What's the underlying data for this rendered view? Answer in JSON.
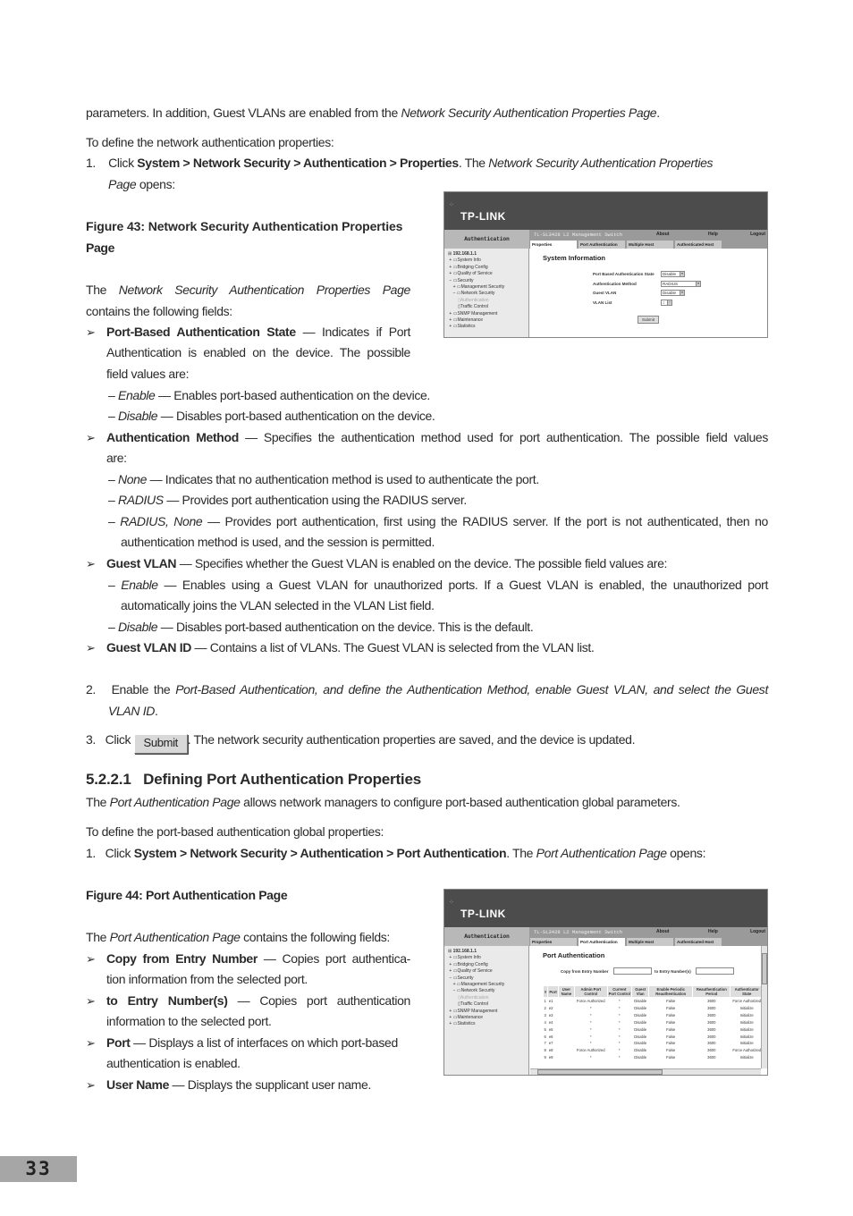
{
  "doc": {
    "p_intro_end": {
      "a": "parameters. In addition, Guest VLANs are enabled from the ",
      "b": "Network Security Authentication Properties Page",
      "c": "."
    },
    "p_define": "To define the network authentication properties:",
    "step1": {
      "num": "1.",
      "a": "Click ",
      "b": "System > Network Security > Authentication > Properties",
      "c": ". The ",
      "d": "Network Security Authentication Properties",
      "e": "Page",
      "f": " opens:"
    },
    "fig43_caption_1": "Figure 43: Network Security Authentication Properties",
    "fig43_caption_2": "Page",
    "fig43_intro": {
      "a": "The ",
      "b": "Network Security Authentication Properties Page",
      "c": "contains the following fields:"
    },
    "fields1": [
      {
        "name": "Port-Based Authentication State",
        "desc_1": " — Indicates if Port",
        "desc_2": "Authentication is enabled on the device. The possible",
        "desc_3": "field values are:",
        "values": [
          {
            "name": "Enable",
            "desc": " — Enables port-based authentication on the device."
          },
          {
            "name": "Disable",
            "desc": " — Disables port-based authentication on the device."
          }
        ]
      },
      {
        "name": "Authentication Method",
        "desc_1": " — Specifies the authentication method used for port authentication. The possible field values",
        "desc_2": "are:",
        "values": [
          {
            "name": "None",
            "desc": " — Indicates that no authentication method is used to authenticate the port."
          },
          {
            "name": "RADIUS",
            "desc": " — Provides port authentication using the RADIUS server."
          },
          {
            "name": "RADIUS, None",
            "desc": " — Provides port authentication, first using the RADIUS server. If the port is not authenticated, then no",
            "desc_2": "authentication method is used, and the session is permitted."
          }
        ]
      },
      {
        "name": "Guest VLAN",
        "desc_1": " — Specifies whether the Guest VLAN is enabled on the device. The possible field values are:",
        "values": [
          {
            "name": "Enable",
            "desc": " — Enables using a Guest VLAN for unauthorized ports. If a Guest VLAN is enabled, the unauthorized port",
            "desc_2": "automatically joins the VLAN selected in the VLAN List field."
          },
          {
            "name": "Disable",
            "desc": " — Disables port-based authentication on the device. This is the default."
          }
        ]
      },
      {
        "name": "Guest VLAN ID",
        "desc_1": " — Contains a list of VLANs. The Guest VLAN is selected from the VLAN list."
      }
    ],
    "step2": {
      "num": "2.",
      "a": "Enable the ",
      "b": "Port-Based Authentication, and define the Authentication Method, enable Guest VLAN, and select the Guest",
      "c": "VLAN ID",
      "d": "."
    },
    "step3": {
      "num": "3.",
      "a": "Click ",
      "button": "Submit",
      "b": ". The network security authentication properties are saved, and the device is updated."
    },
    "section_heading": "5.2.2.1   Defining Port Authentication Properties",
    "section_p1": {
      "a": "The ",
      "b": "Port Authentication Page",
      "c": " allows network managers to configure port-based authentication global parameters."
    },
    "section_p2": "To define the port-based authentication global properties:",
    "section_step1": {
      "num": "1.",
      "a": "Click ",
      "b": "System > Network Security > Authentication > Port Authentication",
      "c": ". The ",
      "d": "Port Authentication Page",
      "e": " opens:"
    },
    "fig44_caption": "Figure 44: Port Authentication Page",
    "fig44_intro": {
      "a": "The ",
      "b": "Port Authentication Page",
      "c": " contains the following fields:"
    },
    "fields2": [
      {
        "name": "Copy from Entry Number",
        "desc_1": " — Copies port authentica-",
        "desc_2": "tion information from the selected port."
      },
      {
        "name": "to Entry Number(s)",
        "desc_1": " — Copies port authentication",
        "desc_2": "information to the selected port."
      },
      {
        "name": "Port",
        "desc_1": " — Displays a list of interfaces on which port-based",
        "desc_2": "authentication is enabled."
      },
      {
        "name": "User Name",
        "desc_1": " — Displays the supplicant user name."
      }
    ],
    "bullet_glyph": "➢",
    "page_number": "33"
  },
  "ui": {
    "logo": "TP-LINK",
    "sidebar_title": "Authentication",
    "product": "TL-SL3428 L2 Management Switch",
    "links": {
      "about": "About",
      "help": "Help",
      "logout": "Logout"
    },
    "tabs": [
      "Properties",
      "Port Authentication",
      "Multiple Host",
      "Authenticated Host"
    ],
    "tree": [
      {
        "label": "192.168.1.1",
        "prefix": "⊞"
      },
      {
        "label": "System Info",
        "prefix": "+"
      },
      {
        "label": "Bridging Config",
        "prefix": "+"
      },
      {
        "label": "Quality of Service",
        "prefix": "+"
      },
      {
        "label": "Security",
        "prefix": "−"
      },
      {
        "label": "Management Security",
        "prefix": "+"
      },
      {
        "label": "Network Security",
        "prefix": "−"
      },
      {
        "label": "Authentication",
        "prefix": ""
      },
      {
        "label": "Traffic Control",
        "prefix": ""
      },
      {
        "label": "SNMP Management",
        "prefix": "+"
      },
      {
        "label": "Maintenance",
        "prefix": "+"
      },
      {
        "label": "Statistics",
        "prefix": "+"
      }
    ],
    "props": {
      "title": "System Information",
      "fields": [
        {
          "label": "Port Based Authentication State",
          "value": "Disable"
        },
        {
          "label": "Authentication Method",
          "value": "RADIUS"
        },
        {
          "label": "Guest VLAN",
          "value": "Disable"
        },
        {
          "label": "VLAN List",
          "value": "2"
        }
      ],
      "submit": "Submit"
    },
    "portauth": {
      "title": "Port Authentication",
      "copy_from_label": "Copy from Entry Number",
      "copy_from_value": "",
      "to_label": "to Entry Number(s)",
      "to_value": "",
      "columns": [
        "#",
        "Port",
        "User Name",
        "Admin Port Control",
        "Current Port Control",
        "Guest Vlan",
        "Enable Periodic Reauthentication",
        "Reauthentication Period",
        "Authenticator State"
      ],
      "rows": [
        [
          "1",
          "e1",
          "",
          "Force Authorized",
          "*",
          "Disable",
          "False",
          "3600",
          "Force Authorized"
        ],
        [
          "2",
          "e2",
          "",
          "*",
          "*",
          "Disable",
          "False",
          "3600",
          "Initialize"
        ],
        [
          "3",
          "e3",
          "",
          "*",
          "*",
          "Disable",
          "False",
          "3600",
          "Initialize"
        ],
        [
          "4",
          "e4",
          "",
          "*",
          "*",
          "Disable",
          "False",
          "3600",
          "Initialize"
        ],
        [
          "5",
          "e5",
          "",
          "*",
          "*",
          "Disable",
          "False",
          "3600",
          "Initialize"
        ],
        [
          "6",
          "e6",
          "",
          "*",
          "*",
          "Disable",
          "False",
          "3600",
          "Initialize"
        ],
        [
          "7",
          "e7",
          "",
          "*",
          "*",
          "Disable",
          "False",
          "3600",
          "Initialize"
        ],
        [
          "8",
          "e8",
          "",
          "Force Authorized",
          "*",
          "Disable",
          "False",
          "3600",
          "Force Authorized"
        ],
        [
          "9",
          "e9",
          "",
          "*",
          "*",
          "Disable",
          "False",
          "3600",
          "Initialize"
        ]
      ]
    }
  }
}
